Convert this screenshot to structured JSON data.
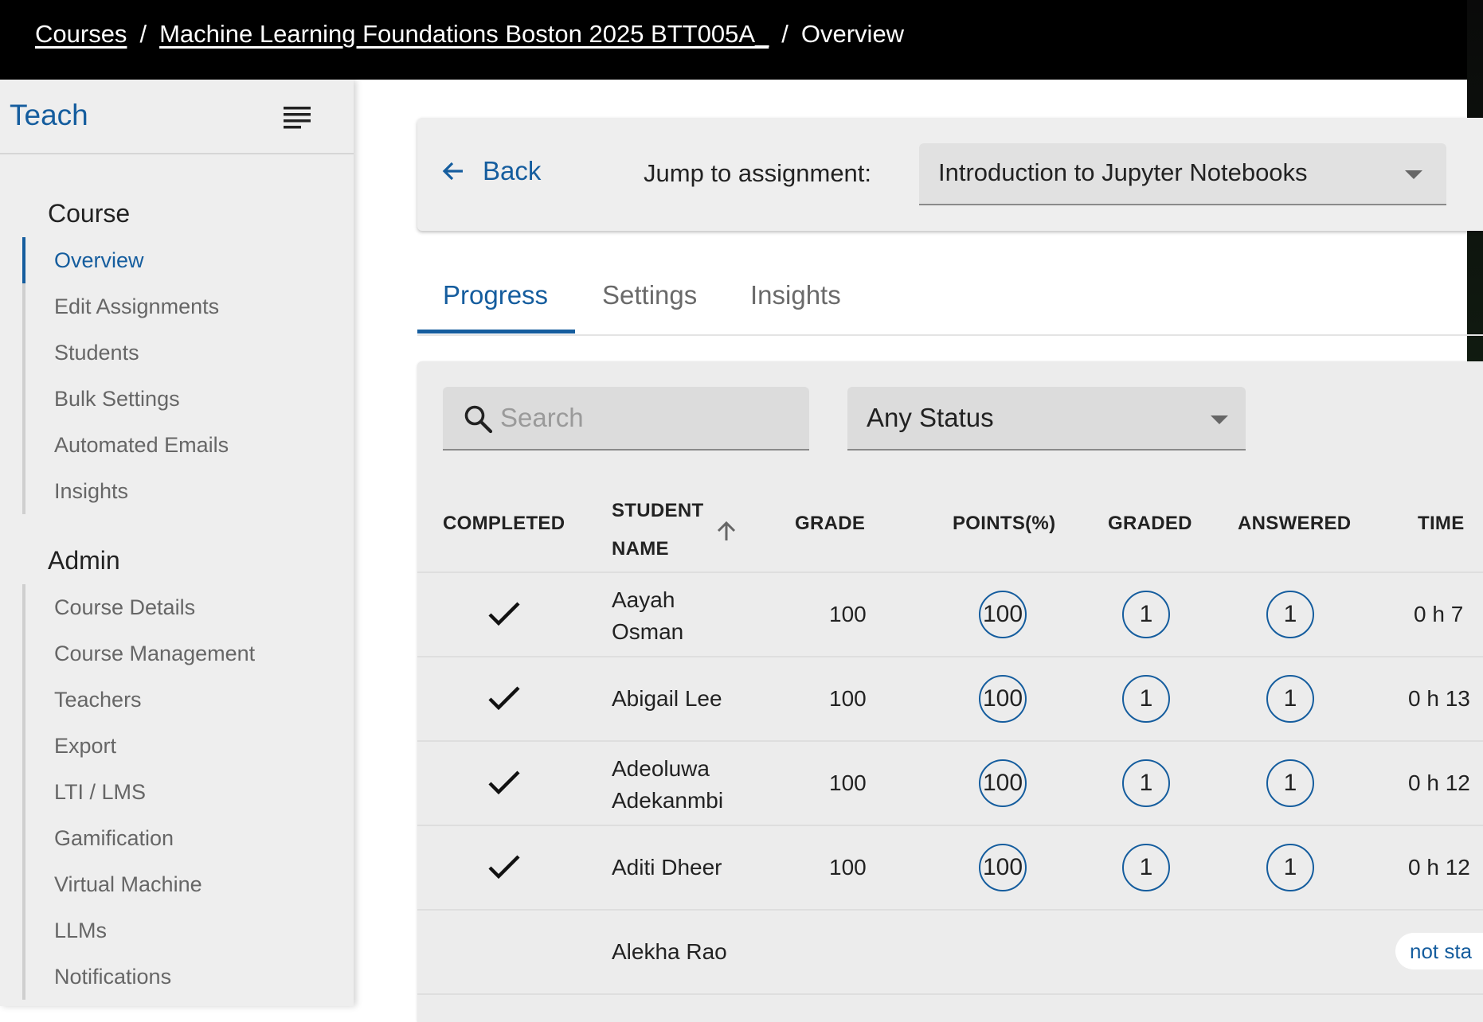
{
  "breadcrumb": {
    "courses": "Courses",
    "course": "Machine Learning Foundations Boston 2025 BTT005A_",
    "current": "Overview",
    "separator": "/"
  },
  "sidebar": {
    "title": "Teach",
    "course_heading": "Course",
    "course_items": [
      "Overview",
      "Edit Assignments",
      "Students",
      "Bulk Settings",
      "Automated Emails",
      "Insights"
    ],
    "admin_heading": "Admin",
    "admin_items": [
      "Course Details",
      "Course Management",
      "Teachers",
      "Export",
      "LTI / LMS",
      "Gamification",
      "Virtual Machine",
      "LLMs",
      "Notifications"
    ]
  },
  "topcard": {
    "back_label": "Back",
    "jump_label": "Jump to assignment:",
    "assignment": "Introduction to Jupyter Notebooks"
  },
  "tabs": [
    "Progress",
    "Settings",
    "Insights"
  ],
  "filters": {
    "search_placeholder": "Search",
    "status": "Any Status"
  },
  "table": {
    "headers": {
      "completed": "COMPLETED",
      "student_1": "STUDENT",
      "student_2": "NAME",
      "grade": "GRADE",
      "points": "POINTS(%)",
      "graded": "GRADED",
      "answered": "ANSWERED",
      "time": "TIME"
    },
    "rows": [
      {
        "name1": "Aayah",
        "name2": "Osman",
        "grade": "100",
        "points": "100",
        "graded": "1",
        "answered": "1",
        "time": "0 h 7"
      },
      {
        "name1": "Abigail Lee",
        "name2": "",
        "grade": "100",
        "points": "100",
        "graded": "1",
        "answered": "1",
        "time": "0 h 13"
      },
      {
        "name1": "Adeoluwa",
        "name2": "Adekanmbi",
        "grade": "100",
        "points": "100",
        "graded": "1",
        "answered": "1",
        "time": "0 h 12"
      },
      {
        "name1": "Aditi Dheer",
        "name2": "",
        "grade": "100",
        "points": "100",
        "graded": "1",
        "answered": "1",
        "time": "0 h 12"
      },
      {
        "name1": "Alekha Rao",
        "name2": "",
        "status_pill": "not sta"
      }
    ]
  },
  "colors": {
    "accent": "#155d9e",
    "topbar": "#000000"
  }
}
